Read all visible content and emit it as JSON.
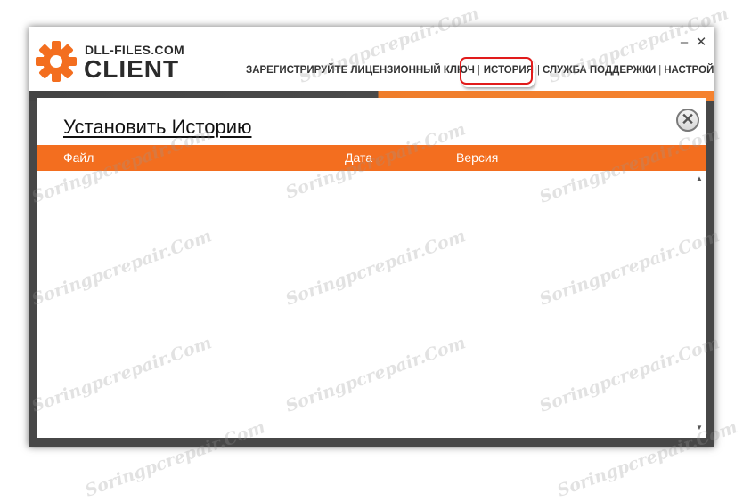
{
  "app": {
    "logo_top": "DLL-FILES.COM",
    "logo_bottom": "CLIENT"
  },
  "window_controls": {
    "minimize": "–",
    "close": "✕"
  },
  "nav": {
    "register": "ЗАРЕГИСТРИРУЙТЕ ЛИЦЕНЗИОННЫЙ КЛЮЧ",
    "history": "ИСТОРИЯ",
    "support": "СЛУЖБА ПОДДЕРЖКИ",
    "settings": "НАСТРОЙКИ",
    "separator": "|"
  },
  "modal": {
    "title": "Установить Историю",
    "close": "✕",
    "columns": [
      "Файл",
      "Дата",
      "Версия"
    ],
    "rows": []
  },
  "scrollbar": {
    "up": "▲",
    "down": "▼"
  },
  "watermark": "Soringpcrepair.Com",
  "colors": {
    "accent_orange": "#f36e1f",
    "highlight_red": "#e11b1b",
    "frame_dark": "#474747"
  },
  "icons": {
    "logo": "gear-icon",
    "close": "close-icon",
    "scroll_up": "chevron-up-icon",
    "scroll_down": "chevron-down-icon"
  }
}
